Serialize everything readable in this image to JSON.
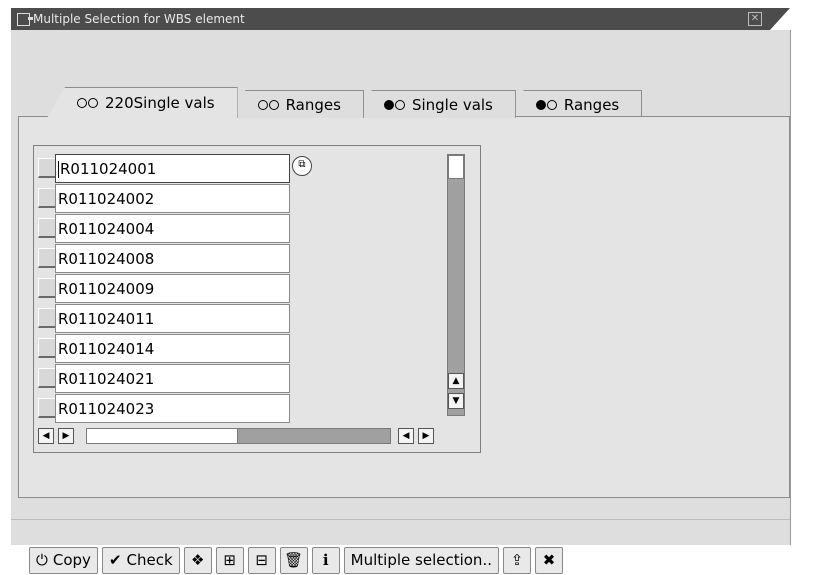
{
  "window": {
    "title": "Multiple Selection for WBS element"
  },
  "tabs": [
    {
      "label": "220Single vals",
      "icon": "include-icon",
      "active": true
    },
    {
      "label": "Ranges",
      "icon": "include-icon",
      "active": false
    },
    {
      "label": "Single vals",
      "icon": "exclude-icon",
      "active": false
    },
    {
      "label": "Ranges",
      "icon": "exclude-icon",
      "active": false
    }
  ],
  "table": {
    "rows": [
      {
        "value": "R011024001"
      },
      {
        "value": "R011024002"
      },
      {
        "value": "R011024004"
      },
      {
        "value": "R011024008"
      },
      {
        "value": "R011024009"
      },
      {
        "value": "R011024011"
      },
      {
        "value": "R011024014"
      },
      {
        "value": "R011024021"
      },
      {
        "value": "R011024023"
      }
    ],
    "f4_help_icon": "search-help-icon"
  },
  "toolbar": {
    "copy_label": "Copy",
    "check_label": "Check",
    "multiple_label": "Multiple selection..",
    "icons": [
      "copy-icon",
      "check-icon",
      "options-icon",
      "insert-row-icon",
      "delete-row-icon",
      "trash-icon",
      "info-icon",
      "upload-icon",
      "cancel-icon"
    ]
  }
}
